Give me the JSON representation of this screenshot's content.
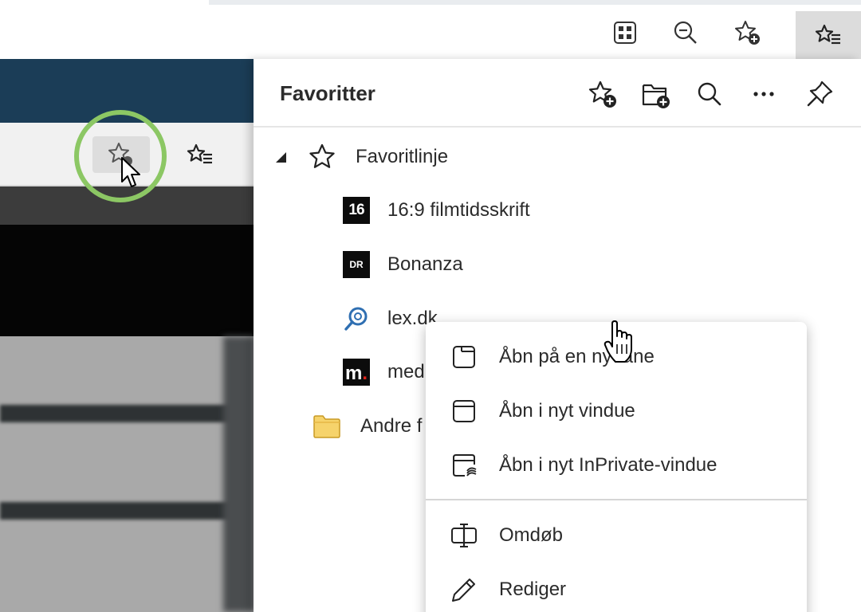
{
  "toolbar": {
    "buttons": [
      {
        "name": "apps-icon"
      },
      {
        "name": "zoom-out-icon"
      },
      {
        "name": "add-favorite-icon"
      },
      {
        "name": "favorites-hub-icon"
      }
    ]
  },
  "favorites_panel": {
    "title": "Favoritter",
    "header_buttons": [
      {
        "name": "add-favorite-icon"
      },
      {
        "name": "add-folder-icon"
      },
      {
        "name": "search-icon"
      },
      {
        "name": "more-icon"
      },
      {
        "name": "pin-icon"
      }
    ],
    "tree": {
      "root_label": "Favoritlinje",
      "items": [
        {
          "icon_text": "16",
          "label": "16:9 filmtidsskrift"
        },
        {
          "icon_text": "DR",
          "label": "Bonanza"
        },
        {
          "icon_text": "",
          "label": "lex.dk"
        },
        {
          "icon_text": "m",
          "label": "med"
        }
      ],
      "other_folder_label": "Andre f"
    }
  },
  "context_menu": {
    "items": [
      {
        "label": "Åbn på en ny fane",
        "icon": "new-tab-icon"
      },
      {
        "label": "Åbn i nyt vindue",
        "icon": "new-window-icon"
      },
      {
        "label": "Åbn i nyt InPrivate-vindue",
        "icon": "inprivate-window-icon"
      },
      {
        "label": "Omdøb",
        "icon": "rename-icon"
      },
      {
        "label": "Rediger",
        "icon": "edit-icon"
      }
    ]
  },
  "colors": {
    "highlight_circle": "#8cc764",
    "panel_bg": "#ffffff",
    "hub_button_active": "#dcdcdc"
  }
}
